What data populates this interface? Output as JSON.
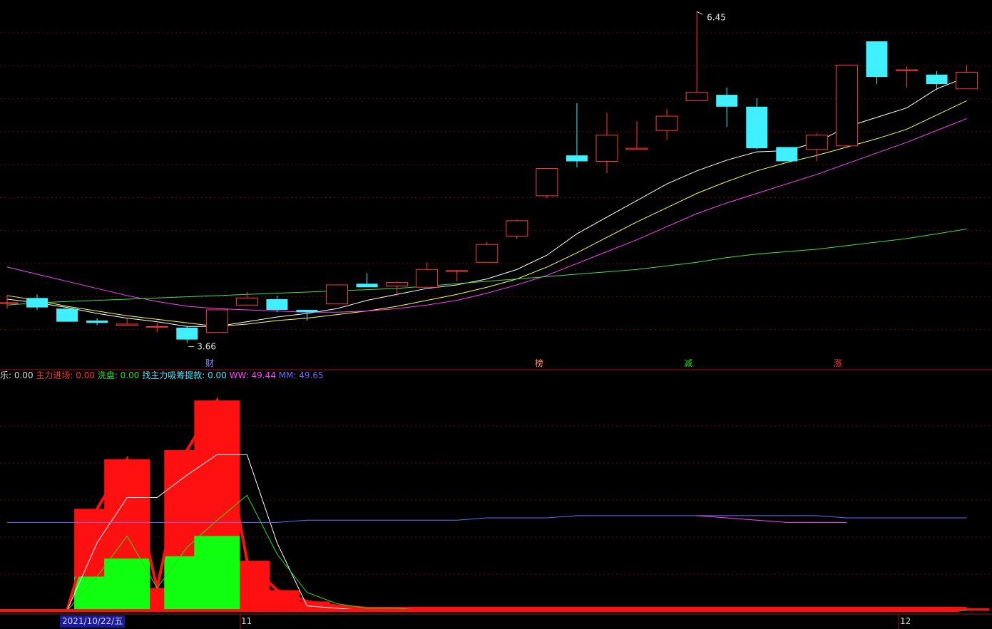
{
  "legend": {
    "items": [
      {
        "key": "l0",
        "label": "乐: ",
        "value": "0.00",
        "color": "#d8d8d8"
      },
      {
        "key": "l1",
        "label": "主力进场: ",
        "value": "0.00",
        "color": "#ff3030"
      },
      {
        "key": "l2",
        "label": "洗盘: ",
        "value": "0.00",
        "color": "#20e020"
      },
      {
        "key": "l3",
        "label": "找主力吸筹提款: ",
        "value": "0.00",
        "color": "#40e8ff"
      },
      {
        "key": "l4",
        "label": "WW: ",
        "value": "49.44",
        "color": "#ff40ff"
      },
      {
        "key": "l5",
        "label": "MM: ",
        "value": "49.65",
        "color": "#6a6aff"
      }
    ]
  },
  "axis": {
    "date_label": "2021/10/22/五",
    "tick_11": "11",
    "tick_12": "12"
  },
  "chart_data": [
    {
      "type": "candlestick",
      "annotations": {
        "high_label": "6.45",
        "low_label": "3.66"
      },
      "event_markers": [
        {
          "text": "财",
          "color": "#9090ff"
        },
        {
          "text": "榜",
          "color": "#ff9040"
        },
        {
          "text": "减",
          "color": "#20e020"
        },
        {
          "text": "涨",
          "color": "#ff3030"
        }
      ],
      "ylim": [
        3.55,
        6.5
      ],
      "candles": [
        {
          "o": 4.0,
          "h": 4.06,
          "l": 3.95,
          "c": 4.0
        },
        {
          "o": 4.04,
          "h": 4.07,
          "l": 3.94,
          "c": 3.96
        },
        {
          "o": 3.95,
          "h": 3.95,
          "l": 3.84,
          "c": 3.84
        },
        {
          "o": 3.85,
          "h": 3.87,
          "l": 3.81,
          "c": 3.83
        },
        {
          "o": 3.81,
          "h": 3.87,
          "l": 3.81,
          "c": 3.82
        },
        {
          "o": 3.8,
          "h": 3.83,
          "l": 3.75,
          "c": 3.8
        },
        {
          "o": 3.79,
          "h": 3.8,
          "l": 3.66,
          "c": 3.69
        },
        {
          "o": 3.75,
          "h": 3.95,
          "l": 3.75,
          "c": 3.94
        },
        {
          "o": 3.98,
          "h": 4.09,
          "l": 3.98,
          "c": 4.04
        },
        {
          "o": 4.03,
          "h": 4.06,
          "l": 3.92,
          "c": 3.94
        },
        {
          "o": 3.94,
          "h": 3.94,
          "l": 3.85,
          "c": 3.92
        },
        {
          "o": 3.99,
          "h": 4.15,
          "l": 3.99,
          "c": 4.15
        },
        {
          "o": 4.16,
          "h": 4.25,
          "l": 4.13,
          "c": 4.13
        },
        {
          "o": 4.14,
          "h": 4.18,
          "l": 4.06,
          "c": 4.17
        },
        {
          "o": 4.13,
          "h": 4.34,
          "l": 4.13,
          "c": 4.28
        },
        {
          "o": 4.27,
          "h": 4.27,
          "l": 4.18,
          "c": 4.27
        },
        {
          "o": 4.34,
          "h": 4.51,
          "l": 4.34,
          "c": 4.49
        },
        {
          "o": 4.56,
          "h": 4.7,
          "l": 4.54,
          "c": 4.69
        },
        {
          "o": 4.9,
          "h": 4.9,
          "l": 4.88,
          "c": 5.13
        },
        {
          "o": 5.24,
          "h": 5.68,
          "l": 5.14,
          "c": 5.19
        },
        {
          "o": 5.19,
          "h": 5.6,
          "l": 5.09,
          "c": 5.41
        },
        {
          "o": 5.29,
          "h": 5.53,
          "l": 5.29,
          "c": 5.3
        },
        {
          "o": 5.45,
          "h": 5.63,
          "l": 5.37,
          "c": 5.57
        },
        {
          "o": 5.7,
          "h": 6.45,
          "l": 5.7,
          "c": 5.77
        },
        {
          "o": 5.75,
          "h": 5.81,
          "l": 5.48,
          "c": 5.65
        },
        {
          "o": 5.65,
          "h": 5.72,
          "l": 5.29,
          "c": 5.3
        },
        {
          "o": 5.31,
          "h": 5.31,
          "l": 5.19,
          "c": 5.19
        },
        {
          "o": 5.29,
          "h": 5.43,
          "l": 5.19,
          "c": 5.41
        },
        {
          "o": 5.32,
          "h": 6.0,
          "l": 5.32,
          "c": 6.0
        },
        {
          "o": 6.2,
          "h": 6.2,
          "l": 5.84,
          "c": 5.9
        },
        {
          "o": 5.96,
          "h": 5.99,
          "l": 5.81,
          "c": 5.96
        },
        {
          "o": 5.92,
          "h": 5.95,
          "l": 5.79,
          "c": 5.84
        },
        {
          "o": 5.8,
          "h": 6.0,
          "l": 5.8,
          "c": 5.94
        }
      ],
      "series": [
        {
          "color": "#ffffff",
          "values": [
            4.03,
            4.0,
            3.96,
            3.91,
            3.87,
            3.84,
            3.8,
            3.8,
            3.84,
            3.88,
            3.91,
            3.95,
            4.02,
            4.07,
            4.12,
            4.15,
            4.2,
            4.28,
            4.4,
            4.58,
            4.72,
            4.86,
            5.0,
            5.11,
            5.2,
            5.27,
            5.28,
            5.35,
            5.48,
            5.56,
            5.64,
            5.8,
            5.9
          ]
        },
        {
          "color": "#ffff40",
          "values": [
            4.06,
            4.02,
            3.97,
            3.93,
            3.89,
            3.86,
            3.83,
            3.8,
            3.82,
            3.85,
            3.87,
            3.9,
            3.93,
            3.97,
            4.02,
            4.07,
            4.13,
            4.2,
            4.3,
            4.42,
            4.55,
            4.68,
            4.8,
            4.92,
            5.02,
            5.11,
            5.18,
            5.24,
            5.31,
            5.38,
            5.46,
            5.58,
            5.7
          ]
        },
        {
          "color": "#ff40ff",
          "values": [
            4.3,
            4.24,
            4.18,
            4.12,
            4.06,
            4.01,
            3.97,
            3.95,
            3.94,
            3.93,
            3.92,
            3.92,
            3.93,
            3.95,
            3.98,
            4.02,
            4.08,
            4.15,
            4.23,
            4.33,
            4.43,
            4.53,
            4.64,
            4.75,
            4.84,
            4.92,
            5.0,
            5.08,
            5.17,
            5.26,
            5.35,
            5.45,
            5.55
          ]
        },
        {
          "color": "#40e040",
          "values": [
            3.98,
            4.0,
            4.01,
            4.02,
            4.03,
            4.04,
            4.05,
            4.06,
            4.07,
            4.08,
            4.09,
            4.1,
            4.11,
            4.12,
            4.14,
            4.16,
            4.18,
            4.2,
            4.22,
            4.24,
            4.26,
            4.28,
            4.31,
            4.34,
            4.38,
            4.41,
            4.43,
            4.45,
            4.48,
            4.51,
            4.54,
            4.58,
            4.62
          ]
        }
      ]
    },
    {
      "type": "bar",
      "ylim": [
        0,
        100
      ],
      "red_bars": [
        0,
        0,
        0,
        45,
        67,
        10,
        71,
        93,
        22,
        9,
        4,
        2,
        1,
        1,
        1,
        1,
        1,
        1,
        1,
        1,
        1,
        1,
        1,
        1,
        1,
        1,
        1,
        1,
        1,
        1,
        1,
        1,
        1
      ],
      "green_bars": [
        0,
        0,
        0,
        15,
        23,
        0,
        24,
        33,
        0,
        0,
        0,
        0,
        0,
        0,
        0,
        0,
        0,
        0,
        0,
        0,
        0,
        0,
        0,
        0,
        0,
        0,
        0,
        0,
        0,
        0,
        0,
        0,
        0
      ],
      "series": [
        {
          "color": "#ffffff",
          "values": [
            0,
            0,
            0,
            30,
            50,
            50,
            60,
            69,
            69,
            30,
            2,
            1,
            0,
            0,
            0,
            0,
            0,
            0,
            0,
            0,
            0,
            0,
            0,
            0,
            0,
            0,
            0,
            0,
            0,
            0,
            0,
            0,
            0
          ]
        },
        {
          "color": "#20e020",
          "values": [
            0,
            0,
            0,
            15,
            33,
            10,
            28,
            40,
            51,
            25,
            8,
            3,
            1,
            1,
            0,
            0,
            0,
            0,
            0,
            0,
            0,
            0,
            0,
            0,
            0,
            0,
            0,
            0,
            0,
            0,
            0,
            0,
            0
          ]
        },
        {
          "color": "#6a6aff",
          "values": [
            39,
            39,
            39,
            39,
            39,
            39,
            39,
            39,
            39,
            39,
            40,
            40,
            40,
            40,
            40,
            40,
            41,
            41,
            41,
            42,
            42,
            42,
            42,
            42,
            42,
            42,
            42,
            42,
            41,
            41,
            41,
            41,
            41
          ]
        },
        {
          "color": "#ff40ff",
          "values": [
            null,
            null,
            null,
            null,
            null,
            null,
            null,
            null,
            null,
            null,
            null,
            null,
            null,
            null,
            null,
            null,
            null,
            null,
            null,
            null,
            null,
            null,
            null,
            42,
            41,
            40,
            39,
            39,
            39,
            null,
            null,
            null,
            null
          ]
        }
      ]
    }
  ]
}
